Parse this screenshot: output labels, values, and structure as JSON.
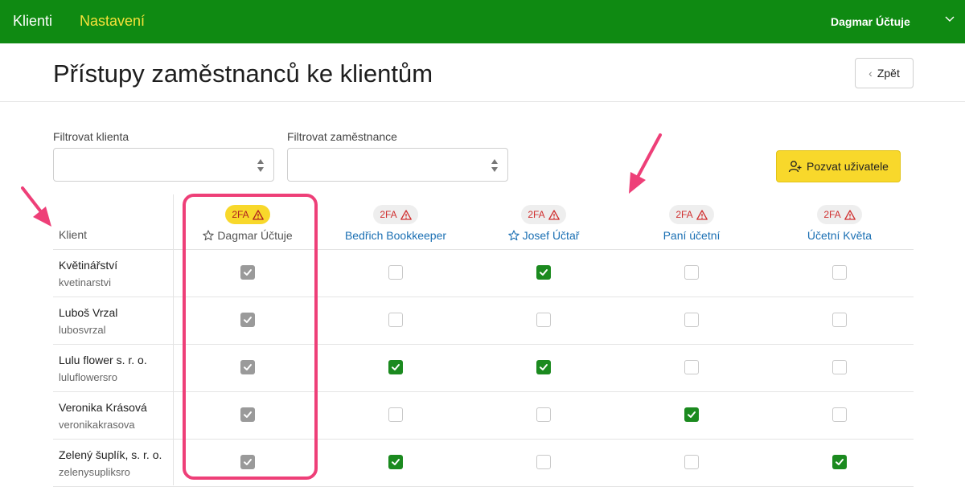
{
  "topbar": {
    "brand": "Klienti",
    "settings": "Nastavení",
    "user": "Dagmar Účtuje"
  },
  "page": {
    "title": "Přístupy zaměstnanců ke klientům",
    "back_label": "Zpět"
  },
  "filters": {
    "client_label": "Filtrovat klienta",
    "employee_label": "Filtrovat zaměstnance",
    "client_value": "",
    "employee_value": ""
  },
  "invite_label": "Pozvat uživatele",
  "table": {
    "client_header": "Klient",
    "badge_label": "2FA",
    "employees": [
      {
        "name": "Dagmar Účtuje",
        "star": true,
        "current": true
      },
      {
        "name": "Bedřich Bookkeeper",
        "star": false,
        "current": false
      },
      {
        "name": "Josef Účtař",
        "star": true,
        "current": false
      },
      {
        "name": "Paní účetní",
        "star": false,
        "current": false
      },
      {
        "name": "Účetní Květa",
        "star": false,
        "current": false
      }
    ],
    "rows": [
      {
        "name": "Květinářství",
        "id": "kvetinarstvi",
        "access": [
          true,
          false,
          true,
          false,
          false
        ]
      },
      {
        "name": "Luboš Vrzal",
        "id": "lubosvrzal",
        "access": [
          true,
          false,
          false,
          false,
          false
        ]
      },
      {
        "name": "Lulu flower s. r. o.",
        "id": "luluflowersro",
        "access": [
          true,
          true,
          true,
          false,
          false
        ]
      },
      {
        "name": "Veronika Krásová",
        "id": "veronikakrasova",
        "access": [
          true,
          false,
          false,
          true,
          false
        ]
      },
      {
        "name": "Zelený šuplík, s. r. o.",
        "id": "zelenysupliksro",
        "access": [
          true,
          true,
          false,
          false,
          true
        ]
      }
    ]
  },
  "colors": {
    "topbar": "#0f8a12",
    "accent_yellow": "#f8d82b",
    "link_blue": "#1a6fb3",
    "checked_green": "#1b8a1f",
    "highlight_pink": "#ee3f78"
  },
  "icons": [
    "chevron-down-icon",
    "chevron-left-icon",
    "select-arrows-icon",
    "user-plus-icon",
    "warning-icon",
    "star-icon",
    "check-icon",
    "annotation-arrow"
  ]
}
